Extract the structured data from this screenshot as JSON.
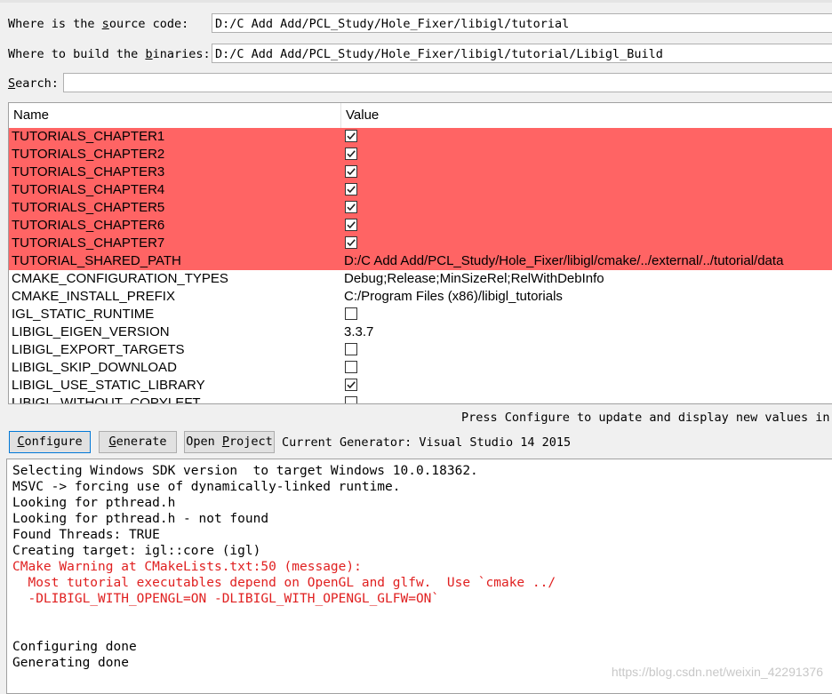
{
  "paths": {
    "source_label_pre": "Where is the ",
    "source_label_key": "s",
    "source_label_post": "ource code:",
    "source_value": "D:/C Add Add/PCL_Study/Hole_Fixer/libigl/tutorial",
    "build_label_pre": "Where to build the ",
    "build_label_key": "b",
    "build_label_post": "inaries:",
    "build_value": "D:/C Add Add/PCL_Study/Hole_Fixer/libigl/tutorial/Libigl_Build",
    "search_label_key": "S",
    "search_label_post": "earch:",
    "search_value": ""
  },
  "table": {
    "col_name": "Name",
    "col_value": "Value",
    "rows": [
      {
        "name": "TUTORIALS_CHAPTER1",
        "type": "bool",
        "checked": true,
        "new": true
      },
      {
        "name": "TUTORIALS_CHAPTER2",
        "type": "bool",
        "checked": true,
        "new": true
      },
      {
        "name": "TUTORIALS_CHAPTER3",
        "type": "bool",
        "checked": true,
        "new": true
      },
      {
        "name": "TUTORIALS_CHAPTER4",
        "type": "bool",
        "checked": true,
        "new": true
      },
      {
        "name": "TUTORIALS_CHAPTER5",
        "type": "bool",
        "checked": true,
        "new": true
      },
      {
        "name": "TUTORIALS_CHAPTER6",
        "type": "bool",
        "checked": true,
        "new": true
      },
      {
        "name": "TUTORIALS_CHAPTER7",
        "type": "bool",
        "checked": true,
        "new": true
      },
      {
        "name": "TUTORIAL_SHARED_PATH",
        "type": "text",
        "value": "D:/C Add Add/PCL_Study/Hole_Fixer/libigl/cmake/../external/../tutorial/data",
        "new": true
      },
      {
        "name": "CMAKE_CONFIGURATION_TYPES",
        "type": "text",
        "value": "Debug;Release;MinSizeRel;RelWithDebInfo",
        "new": false
      },
      {
        "name": "CMAKE_INSTALL_PREFIX",
        "type": "text",
        "value": "C:/Program Files (x86)/libigl_tutorials",
        "new": false
      },
      {
        "name": "IGL_STATIC_RUNTIME",
        "type": "bool",
        "checked": false,
        "new": false
      },
      {
        "name": "LIBIGL_EIGEN_VERSION",
        "type": "text",
        "value": "3.3.7",
        "new": false
      },
      {
        "name": "LIBIGL_EXPORT_TARGETS",
        "type": "bool",
        "checked": false,
        "new": false
      },
      {
        "name": "LIBIGL_SKIP_DOWNLOAD",
        "type": "bool",
        "checked": false,
        "new": false
      },
      {
        "name": "LIBIGL_USE_STATIC_LIBRARY",
        "type": "bool",
        "checked": true,
        "new": false
      },
      {
        "name": "LIBIGL_WITHOUT_COPYLEFT",
        "type": "bool",
        "checked": false,
        "new": false
      }
    ]
  },
  "status": "Press Configure to update and display new values in",
  "buttons": {
    "configure_key": "C",
    "configure_rest": "onfigure",
    "generate_key": "G",
    "generate_rest": "enerate",
    "open_pre": "Open ",
    "open_key": "P",
    "open_rest": "roject"
  },
  "generator": "Current Generator: Visual Studio 14 2015",
  "log": [
    {
      "text": "Selecting Windows SDK version  to target Windows 10.0.18362.",
      "red": false
    },
    {
      "text": "MSVC -> forcing use of dynamically-linked runtime.",
      "red": false
    },
    {
      "text": "Looking for pthread.h",
      "red": false
    },
    {
      "text": "Looking for pthread.h - not found",
      "red": false
    },
    {
      "text": "Found Threads: TRUE",
      "red": false
    },
    {
      "text": "Creating target: igl::core (igl)",
      "red": false
    },
    {
      "text": "CMake Warning at CMakeLists.txt:50 (message):",
      "red": true
    },
    {
      "text": "  Most tutorial executables depend on OpenGL and glfw.  Use `cmake ../",
      "red": true
    },
    {
      "text": "  -DLIBIGL_WITH_OPENGL=ON -DLIBIGL_WITH_OPENGL_GLFW=ON`",
      "red": true
    },
    {
      "text": "",
      "red": false
    },
    {
      "text": "",
      "red": false
    },
    {
      "text": "Configuring done",
      "red": false
    },
    {
      "text": "Generating done",
      "red": false
    }
  ],
  "watermark": "https://blog.csdn.net/weixin_42291376",
  "colors": {
    "new_row": "#ff6464",
    "warning_text": "#e02020"
  }
}
